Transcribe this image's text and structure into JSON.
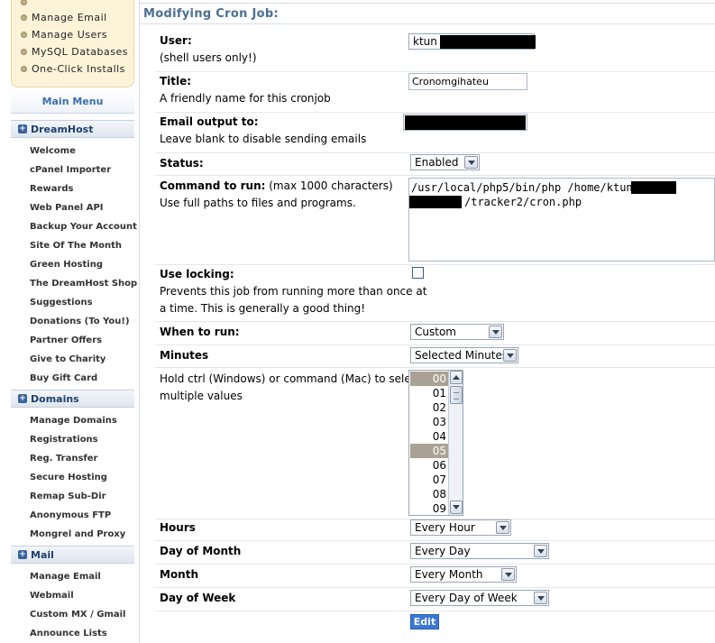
{
  "sidebar": {
    "quick_links": [
      "Manage Email",
      "Manage Users",
      "MySQL Databases",
      "One-Click Installs"
    ],
    "main_menu_label": "Main Menu",
    "sections": [
      {
        "title": "DreamHost",
        "items": [
          "Welcome",
          "cPanel Importer",
          "Rewards",
          "Web Panel API",
          "Backup Your Account",
          "Site Of The Month",
          "Green Hosting",
          "The DreamHost Shop",
          "Suggestions",
          "Donations (To You!)",
          "Partner Offers",
          "Give to Charity",
          "Buy Gift Card"
        ]
      },
      {
        "title": "Domains",
        "items": [
          "Manage Domains",
          "Registrations",
          "Reg. Transfer",
          "Secure Hosting",
          "Remap Sub-Dir",
          "Anonymous FTP",
          "Mongrel and Proxy"
        ]
      },
      {
        "title": "Mail",
        "items": [
          "Manage Email",
          "Webmail",
          "Custom MX / Gmail",
          "Announce Lists"
        ]
      }
    ]
  },
  "page": {
    "title": "Modifying Cron Job:"
  },
  "form": {
    "user": {
      "label": "User:",
      "hint": "(shell users only!)",
      "value": "ktun ("
    },
    "title": {
      "label": "Title:",
      "hint": "A friendly name for this cronjob",
      "value": "Cronomgihateu"
    },
    "email": {
      "label": "Email output to:",
      "hint": "Leave blank to disable sending emails"
    },
    "status": {
      "label": "Status:",
      "value": "Enabled"
    },
    "command": {
      "label": "Command to run:",
      "label_note": " (max 1000 characters)",
      "hint": "Use full paths to files and programs.",
      "line1": "/usr/local/php5/bin/php /home/ktun/",
      "line2": "/tracker2/cron.php"
    },
    "locking": {
      "label": "Use locking:",
      "hint_line1": "Prevents this job from running more than once at",
      "hint_line2": "a time. This is generally a good thing!",
      "checked": false
    },
    "when": {
      "label": "When to run:",
      "value": "Custom"
    },
    "minutes": {
      "label": "Minutes",
      "value": "Selected Minutes",
      "hint_line1": "Hold ctrl (Windows) or command (Mac) to select",
      "hint_line2": "multiple values",
      "options": [
        "00",
        "01",
        "02",
        "03",
        "04",
        "05",
        "06",
        "07",
        "08",
        "09"
      ],
      "selected": [
        "00",
        "05"
      ]
    },
    "hours": {
      "label": "Hours",
      "value": "Every Hour"
    },
    "day_of_month": {
      "label": "Day of Month",
      "value": "Every Day"
    },
    "month": {
      "label": "Month",
      "value": "Every Month"
    },
    "day_of_week": {
      "label": "Day of Week",
      "value": "Every Day of Week"
    },
    "submit_label": "Edit"
  },
  "colors": {
    "title": "#4a6f95",
    "menu_header": "#1f3f6e",
    "quick_box": "#fdf3d8",
    "edit_button": "#3a78d8",
    "selected_option": "#a9a294"
  }
}
